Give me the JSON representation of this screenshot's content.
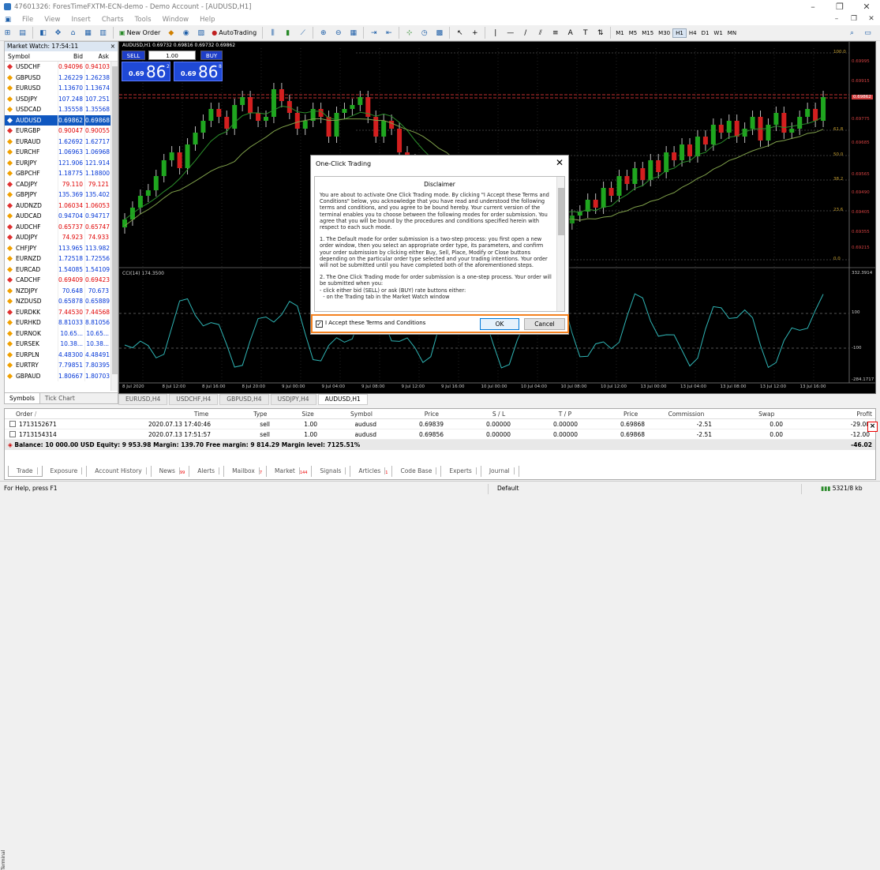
{
  "window": {
    "title": "47601326: ForesTimeFXTM-ECN-demo - Demo Account - [AUDUSD,H1]",
    "min": "–",
    "max": "❐",
    "close": "✕"
  },
  "menu": [
    "File",
    "View",
    "Insert",
    "Charts",
    "Tools",
    "Window",
    "Help"
  ],
  "toolbar": {
    "new_order": "New Order",
    "autotrading": "AutoTrading",
    "timeframes": [
      "M1",
      "M5",
      "M15",
      "M30",
      "H1",
      "H4",
      "D1",
      "W1",
      "MN"
    ]
  },
  "market_watch": {
    "title": "Market Watch: 17:54:11",
    "col_symbol": "Symbol",
    "col_bid": "Bid",
    "col_ask": "Ask",
    "rows": [
      {
        "s": "USDCHF",
        "b": "0.94096",
        "a": "0.94103",
        "c": "dn"
      },
      {
        "s": "GBPUSD",
        "b": "1.26229",
        "a": "1.26238",
        "c": "up"
      },
      {
        "s": "EURUSD",
        "b": "1.13670",
        "a": "1.13674",
        "c": "up"
      },
      {
        "s": "USDJPY",
        "b": "107.248",
        "a": "107.251",
        "c": "up"
      },
      {
        "s": "USDCAD",
        "b": "1.35558",
        "a": "1.35568",
        "c": "up"
      },
      {
        "s": "AUDUSD",
        "b": "0.69862",
        "a": "0.69868",
        "c": "sel"
      },
      {
        "s": "EURGBP",
        "b": "0.90047",
        "a": "0.90055",
        "c": "dn"
      },
      {
        "s": "EURAUD",
        "b": "1.62692",
        "a": "1.62717",
        "c": "up"
      },
      {
        "s": "EURCHF",
        "b": "1.06963",
        "a": "1.06968",
        "c": "up"
      },
      {
        "s": "EURJPY",
        "b": "121.906",
        "a": "121.914",
        "c": "up"
      },
      {
        "s": "GBPCHF",
        "b": "1.18775",
        "a": "1.18800",
        "c": "up"
      },
      {
        "s": "CADJPY",
        "b": "79.110",
        "a": "79.121",
        "c": "dn"
      },
      {
        "s": "GBPJPY",
        "b": "135.369",
        "a": "135.402",
        "c": "up"
      },
      {
        "s": "AUDNZD",
        "b": "1.06034",
        "a": "1.06053",
        "c": "dn"
      },
      {
        "s": "AUDCAD",
        "b": "0.94704",
        "a": "0.94717",
        "c": "up"
      },
      {
        "s": "AUDCHF",
        "b": "0.65737",
        "a": "0.65747",
        "c": "dn"
      },
      {
        "s": "AUDJPY",
        "b": "74.923",
        "a": "74.933",
        "c": "dn"
      },
      {
        "s": "CHFJPY",
        "b": "113.965",
        "a": "113.982",
        "c": "up"
      },
      {
        "s": "EURNZD",
        "b": "1.72518",
        "a": "1.72556",
        "c": "up"
      },
      {
        "s": "EURCAD",
        "b": "1.54085",
        "a": "1.54109",
        "c": "up"
      },
      {
        "s": "CADCHF",
        "b": "0.69409",
        "a": "0.69423",
        "c": "dn"
      },
      {
        "s": "NZDJPY",
        "b": "70.648",
        "a": "70.673",
        "c": "up"
      },
      {
        "s": "NZDUSD",
        "b": "0.65878",
        "a": "0.65889",
        "c": "up"
      },
      {
        "s": "EURDKK",
        "b": "7.44530",
        "a": "7.44568",
        "c": "dn"
      },
      {
        "s": "EURHKD",
        "b": "8.81033",
        "a": "8.81056",
        "c": "up"
      },
      {
        "s": "EURNOK",
        "b": "10.65...",
        "a": "10.65...",
        "c": "up"
      },
      {
        "s": "EURSEK",
        "b": "10.38...",
        "a": "10.38...",
        "c": "up"
      },
      {
        "s": "EURPLN",
        "b": "4.48300",
        "a": "4.48491",
        "c": "up"
      },
      {
        "s": "EURTRY",
        "b": "7.79851",
        "a": "7.80395",
        "c": "up"
      },
      {
        "s": "GBPAUD",
        "b": "1.80667",
        "a": "1.80703",
        "c": "up"
      }
    ],
    "tabs": [
      "Symbols",
      "Tick Chart"
    ]
  },
  "chart": {
    "title": "AUDUSD,H1 0.69732 0.69816 0.69732 0.69862",
    "indicator": "CCI(14) 174.3500",
    "one_click": {
      "sell": "SELL",
      "buy": "BUY",
      "lot": "1.00",
      "sell_small": "0.69",
      "sell_big": "86",
      "sell_sup": "2",
      "buy_small": "0.69",
      "buy_big": "86",
      "buy_sup": "8"
    },
    "y_labels": [
      "0.69995",
      "0.69915",
      "0.69862",
      "0.69775",
      "0.69685",
      "0.69565",
      "0.69490",
      "0.69405",
      "0.69355",
      "0.69215"
    ],
    "fib_labels": [
      "100.0",
      "61.8",
      "50.0",
      "38.2",
      "23.6",
      "0.0"
    ],
    "cci_labels": [
      "332.3914",
      "100",
      "-100",
      "-284.1717"
    ],
    "x_labels": [
      "8 Jul 2020",
      "8 Jul 12:00",
      "8 Jul 16:00",
      "8 Jul 20:00",
      "9 Jul 00:00",
      "9 Jul 04:00",
      "9 Jul 08:00",
      "9 Jul 12:00",
      "9 Jul 16:00",
      "10 Jul 00:00",
      "10 Jul 04:00",
      "10 Jul 08:00",
      "10 Jul 12:00",
      "13 Jul 00:00",
      "13 Jul 04:00",
      "13 Jul 08:00",
      "13 Jul 12:00",
      "13 Jul 16:00"
    ]
  },
  "chart_tabs": [
    "EURUSD,H4",
    "USDCHF,H4",
    "GBPUSD,H4",
    "USDJPY,H4",
    "AUDUSD,H1"
  ],
  "dialog": {
    "title": "One-Click Trading",
    "close": "✕",
    "heading": "Disclaimer",
    "paragraphs": [
      "You are about to activate One Click Trading mode. By clicking \"I Accept these Terms and Conditions\" below, you acknowledge that you have read and understood the following terms and conditions, and you agree to be bound hereby. Your current version of the terminal enables you to choose between the following modes for order submission. You agree that you will be bound by the procedures and conditions specified herein with respect to each such mode.",
      "1. The Default mode for order submission is a two-step process: you first open a new order window, then you select an appropriate order type, its parameters, and confirm your order submission by clicking either Buy, Sell, Place, Modify or Close buttons depending on the particular order type selected and your trading intentions. Your order will not be submitted until you have completed both of the aforementioned steps.",
      "2. The One Click Trading mode for order submission is a one-step process. Your order will be submitted when you:\n- click either bid (SELL) or ask (BUY) rate buttons either:\n  - on the Trading tab in the Market Watch window"
    ],
    "accept": "I Accept these Terms and Conditions",
    "ok": "OK",
    "cancel": "Cancel",
    "check": "✓"
  },
  "terminal": {
    "label": "Terminal",
    "headers": {
      "order": "Order",
      "sort": "/",
      "time": "Time",
      "type": "Type",
      "size": "Size",
      "symbol": "Symbol",
      "price": "Price",
      "sl": "S / L",
      "tp": "T / P",
      "price2": "Price",
      "commission": "Commission",
      "swap": "Swap",
      "profit": "Profit"
    },
    "orders": [
      {
        "order": "1713152671",
        "time": "2020.07.13 17:40:46",
        "type": "sell",
        "size": "1.00",
        "symbol": "audusd",
        "price": "0.69839",
        "sl": "0.00000",
        "tp": "0.00000",
        "price2": "0.69868",
        "commission": "-2.51",
        "swap": "0.00",
        "profit": "-29.00"
      },
      {
        "order": "1713154314",
        "time": "2020.07.13 17:51:57",
        "type": "sell",
        "size": "1.00",
        "symbol": "audusd",
        "price": "0.69856",
        "sl": "0.00000",
        "tp": "0.00000",
        "price2": "0.69868",
        "commission": "-2.51",
        "swap": "0.00",
        "profit": "-12.00"
      }
    ],
    "balance": "Balance: 10 000.00 USD  Equity: 9 953.98  Margin: 139.70  Free margin: 9 814.29  Margin level: 7125.51%",
    "total": "-46.02",
    "close_x": "×",
    "tabs": [
      {
        "l": "Trade",
        "n": ""
      },
      {
        "l": "Exposure",
        "n": ""
      },
      {
        "l": "Account History",
        "n": ""
      },
      {
        "l": "News",
        "n": "99"
      },
      {
        "l": "Alerts",
        "n": ""
      },
      {
        "l": "Mailbox",
        "n": "7"
      },
      {
        "l": "Market",
        "n": "144"
      },
      {
        "l": "Signals",
        "n": ""
      },
      {
        "l": "Articles",
        "n": "1"
      },
      {
        "l": "Code Base",
        "n": ""
      },
      {
        "l": "Experts",
        "n": ""
      },
      {
        "l": "Journal",
        "n": ""
      }
    ]
  },
  "status": {
    "help": "For Help, press F1",
    "profile": "Default",
    "traffic": "5321/8 kb"
  },
  "colors": {
    "bull": "#1fa61f",
    "bear": "#d31f1f",
    "accent": "#f58220",
    "sell_blue": "#1f49d6"
  }
}
